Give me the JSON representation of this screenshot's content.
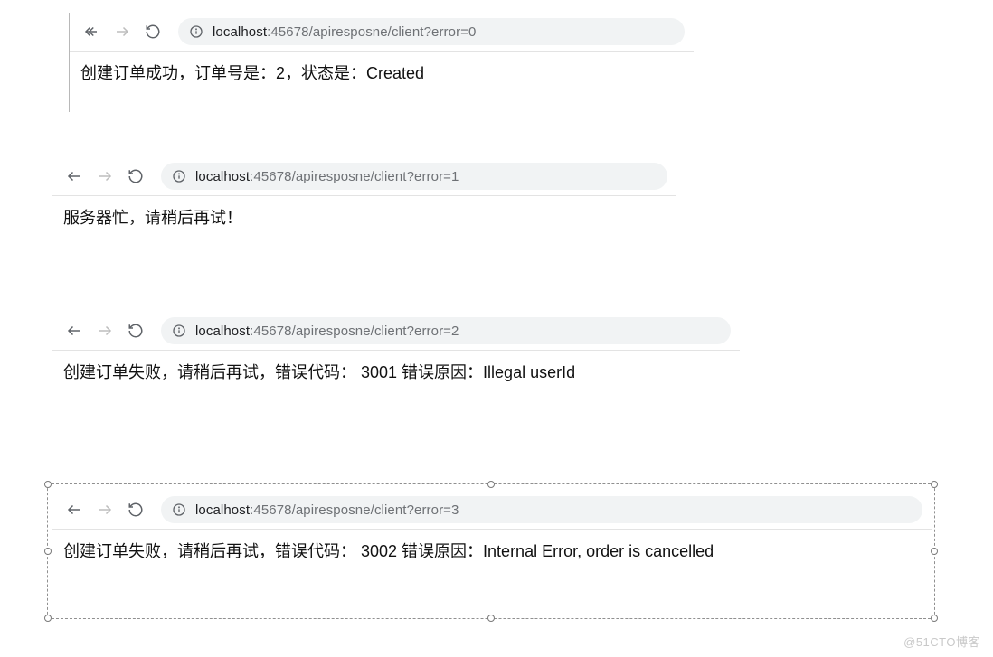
{
  "panels": [
    {
      "url_host": "localhost",
      "url_rest": ":45678/apiresposne/client?error=0",
      "body": "创建订单成功，订单号是：2，状态是：Created"
    },
    {
      "url_host": "localhost",
      "url_rest": ":45678/apiresposne/client?error=1",
      "body": "服务器忙，请稍后再试！"
    },
    {
      "url_host": "localhost",
      "url_rest": ":45678/apiresposne/client?error=2",
      "body": "创建订单失败，请稍后再试，错误代码： 3001 错误原因：Illegal userId"
    },
    {
      "url_host": "localhost",
      "url_rest": ":45678/apiresposne/client?error=3",
      "body": "创建订单失败，请稍后再试，错误代码： 3002 错误原因：Internal Error, order is cancelled"
    }
  ],
  "watermark": "@51CTO博客"
}
